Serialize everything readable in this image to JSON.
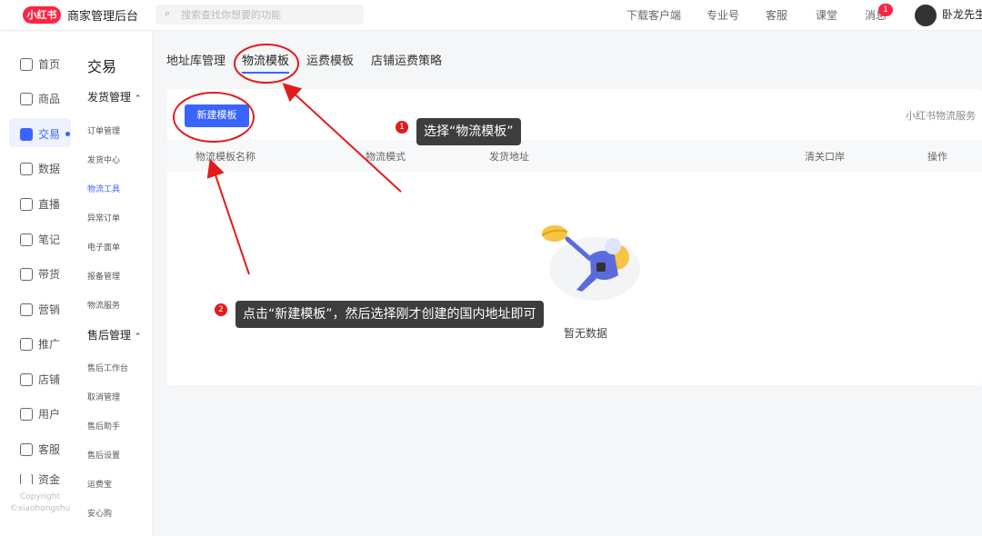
{
  "topbar": {
    "logo": "小红书",
    "app_title": "商家管理后台",
    "search_placeholder": "搜索查找你想要的功能",
    "nav": [
      "下载客户端",
      "专业号",
      "客服",
      "课堂",
      "消息"
    ],
    "message_badge": "1",
    "username": "卧龙先生"
  },
  "sidebar": {
    "items": [
      "首页",
      "商品",
      "交易",
      "数据",
      "直播",
      "笔记",
      "带货",
      "营销",
      "推广",
      "店铺",
      "用户",
      "客服",
      "资金"
    ],
    "active": "交易",
    "copyright_line1": "Copyright",
    "copyright_line2": "©xiaohongshu"
  },
  "subnav": {
    "title": "交易",
    "group1": "发货管理",
    "group1_items": [
      "订单管理",
      "发货中心",
      "物流工具",
      "异常订单",
      "电子面单",
      "报备管理",
      "物流服务"
    ],
    "group2": "售后管理",
    "group2_items": [
      "售后工作台",
      "取消管理",
      "售后助手",
      "售后设置",
      "运费宝",
      "安心购"
    ],
    "active": "物流工具"
  },
  "tabs": [
    "地址库管理",
    "物流模板",
    "运费模板",
    "店铺运费策略"
  ],
  "active_tab": "物流模板",
  "card": {
    "new_button": "新建模板",
    "service_link": "小红书物流服务",
    "columns": [
      "物流模板名称",
      "物流模式",
      "发货地址",
      "清关口岸",
      "操作"
    ],
    "empty_text": "暂无数据"
  },
  "annotations": {
    "step1_num": "1",
    "step1_text": "选择“物流模板”",
    "step2_num": "2",
    "step2_text": "点击“新建模板”，然后选择刚才创建的国内地址即可"
  },
  "colors": {
    "accent": "#3a64ff",
    "brand": "#ff2442",
    "annotation": "#e31b1b"
  }
}
